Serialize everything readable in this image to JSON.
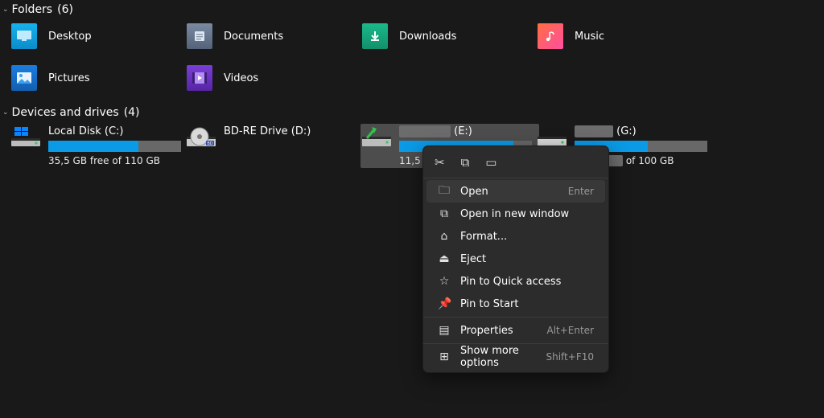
{
  "folders_section": {
    "title": "Folders",
    "count": "(6)"
  },
  "folders": [
    {
      "label": "Desktop"
    },
    {
      "label": "Documents"
    },
    {
      "label": "Downloads"
    },
    {
      "label": "Music"
    },
    {
      "label": "Pictures"
    },
    {
      "label": "Videos"
    }
  ],
  "drives_section": {
    "title": "Devices and drives",
    "count": "(4)"
  },
  "drives": {
    "c": {
      "name": "Local Disk (C:)",
      "free": "35,5 GB free of 110 GB",
      "fillPct": "68%"
    },
    "d": {
      "name": "BD-RE Drive (D:)"
    },
    "e": {
      "suffix": "(E:)",
      "free_prefix": "11,5 GB",
      "fillPct": "86%"
    },
    "g": {
      "suffix": "(G:)",
      "free_suffix": "of 100 GB",
      "fillPct": "55%"
    }
  },
  "ctx": {
    "open": "Open",
    "open_sc": "Enter",
    "newwin": "Open in new window",
    "format": "Format...",
    "eject": "Eject",
    "pinqa": "Pin to Quick access",
    "pinstart": "Pin to Start",
    "props": "Properties",
    "props_sc": "Alt+Enter",
    "more": "Show more options",
    "more_sc": "Shift+F10"
  }
}
